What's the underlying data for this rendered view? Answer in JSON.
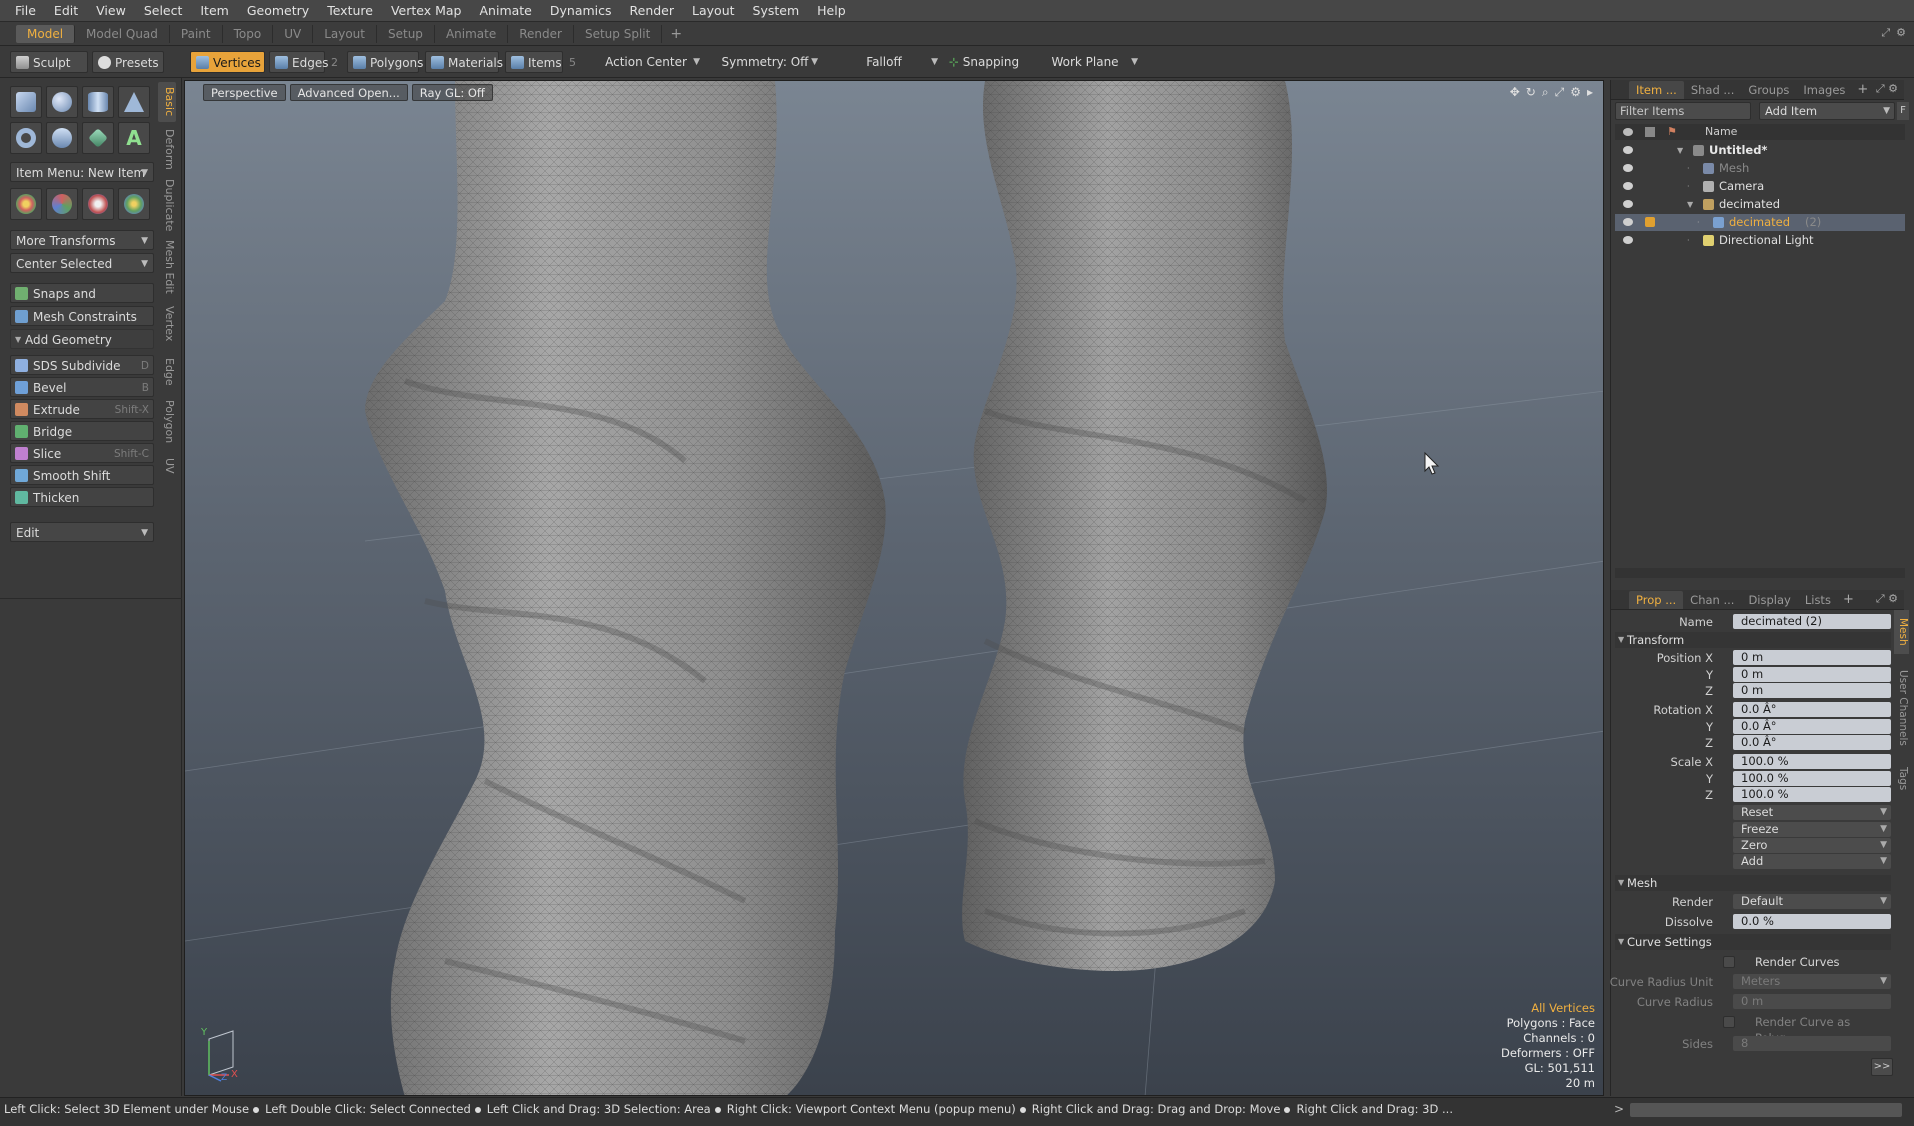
{
  "menu": [
    "File",
    "Edit",
    "View",
    "Select",
    "Item",
    "Geometry",
    "Texture",
    "Vertex Map",
    "Animate",
    "Dynamics",
    "Render",
    "Layout",
    "System",
    "Help"
  ],
  "layout_tabs": [
    "Model",
    "Model Quad",
    "Paint",
    "Topo",
    "UV",
    "Layout",
    "Setup",
    "Animate",
    "Render",
    "Setup Split"
  ],
  "layout_tab_active": "Model",
  "layout_plus": "+",
  "toolbar": {
    "sculpt": "Sculpt",
    "presets": "Presets",
    "vertices": "Vertices",
    "edges": "Edges",
    "edges_count": "2",
    "polygons": "Polygons",
    "materials": "Materials",
    "items": "Items",
    "items_count": "5",
    "action_center": "Action Center",
    "symmetry": "Symmetry: Off",
    "falloff": "Falloff",
    "snapping": "Snapping",
    "work_plane": "Work Plane"
  },
  "left": {
    "tabs": [
      "Basic",
      "Deform",
      "Duplicate",
      "Mesh Edit",
      "Vertex",
      "Edge",
      "Polygon",
      "UV"
    ],
    "item_menu": "Item Menu: New Item",
    "more_transforms": "More Transforms",
    "center_selected": "Center Selected",
    "snaps": "Snaps and Precision",
    "mesh_constraints": "Mesh Constraints",
    "add_geometry": "Add Geometry",
    "tools": [
      {
        "label": "SDS Subdivide",
        "shortcut": "D",
        "color": "#8fb0e0"
      },
      {
        "label": "Bevel",
        "shortcut": "B",
        "color": "#6fa0d8"
      },
      {
        "label": "Extrude",
        "shortcut": "Shift-X",
        "color": "#d08a60"
      },
      {
        "label": "Bridge",
        "shortcut": "",
        "color": "#60b070"
      },
      {
        "label": "Slice",
        "shortcut": "Shift-C",
        "color": "#c080d0"
      },
      {
        "label": "Smooth Shift",
        "shortcut": "",
        "color": "#70a8d8"
      },
      {
        "label": "Thicken",
        "shortcut": "",
        "color": "#60b8a0"
      }
    ],
    "edit": "Edit"
  },
  "viewport": {
    "perspective": "Perspective",
    "advanced": "Advanced Open...",
    "raygl": "Ray GL: Off",
    "info": {
      "all_vertices": "All Vertices",
      "polygons": "Polygons : Face",
      "channels": "Channels : 0",
      "deformers": "Deformers : OFF",
      "gl": "GL: 501,511",
      "distance": "20 m"
    },
    "axis_y": "Y",
    "axis_x": "X",
    "axis_z": "Z"
  },
  "items_panel": {
    "tabs": [
      "Item ...",
      "Shad ...",
      "Groups",
      "Images"
    ],
    "plus": "+",
    "filter_placeholder": "Filter Items",
    "add_item": "Add Item",
    "f_label": "F",
    "col_name": "Name",
    "tree": [
      {
        "label": "Untitled*",
        "indent": 0,
        "bold": true,
        "color": "#e8e8e8",
        "icon": "#8a8a8a"
      },
      {
        "label": "Mesh",
        "indent": 1,
        "bold": false,
        "color": "#8a8a8a",
        "icon": "#7a8aa8"
      },
      {
        "label": "Camera",
        "indent": 1,
        "bold": false,
        "color": "#e0e0e0",
        "icon": "#b0b0b0"
      },
      {
        "label": "decimated",
        "indent": 1,
        "bold": false,
        "color": "#e0e0e0",
        "icon": "#c0a060"
      },
      {
        "label": "decimated",
        "suffix": "(2)",
        "indent": 2,
        "bold": false,
        "color": "#f0b040",
        "icon": "#7aa0d0"
      },
      {
        "label": "Directional Light",
        "indent": 1,
        "bold": false,
        "color": "#e0e0e0",
        "icon": "#e0d070"
      }
    ]
  },
  "props_panel": {
    "tabs": [
      "Prop ...",
      "Chan ...",
      "Display",
      "Lists"
    ],
    "plus": "+",
    "vtabs": [
      "Mesh",
      "User Channels",
      "Tags"
    ],
    "name_label": "Name",
    "name_value": "decimated (2)",
    "transform": "Transform",
    "position_x_label": "Position X",
    "y_label": "Y",
    "z_label": "Z",
    "position": [
      "0 m",
      "0 m",
      "0 m"
    ],
    "rotation_x_label": "Rotation X",
    "rotation": [
      "0.0 Â°",
      "0.0 Â°",
      "0.0 Â°"
    ],
    "scale_x_label": "Scale X",
    "scale": [
      "100.0 %",
      "100.0 %",
      "100.0 %"
    ],
    "reset": "Reset",
    "freeze": "Freeze",
    "zero": "Zero",
    "add": "Add",
    "mesh": "Mesh",
    "render_label": "Render",
    "render_value": "Default",
    "dissolve_label": "Dissolve",
    "dissolve_value": "0.0 %",
    "curve_settings": "Curve Settings",
    "render_curves": "Render Curves",
    "curve_radius_unit_label": "Curve Radius Unit",
    "curve_radius_unit_value": "Meters",
    "curve_radius_label": "Curve Radius",
    "curve_radius_value": "0 m",
    "render_curve_poly": "Render Curve as Polyg...",
    "sides_label": "Sides",
    "sides_value": "8",
    "more": ">>"
  },
  "status": {
    "hints": [
      "Left Click: Select 3D Element under Mouse",
      "Left Double Click: Select Connected",
      "Left Click and Drag: 3D Selection: Area",
      "Right Click: Viewport Context Menu (popup menu)",
      "Right Click and Drag: Drag and Drop: Move",
      "Right Click and Drag: 3D ..."
    ],
    "prompt": ">"
  }
}
